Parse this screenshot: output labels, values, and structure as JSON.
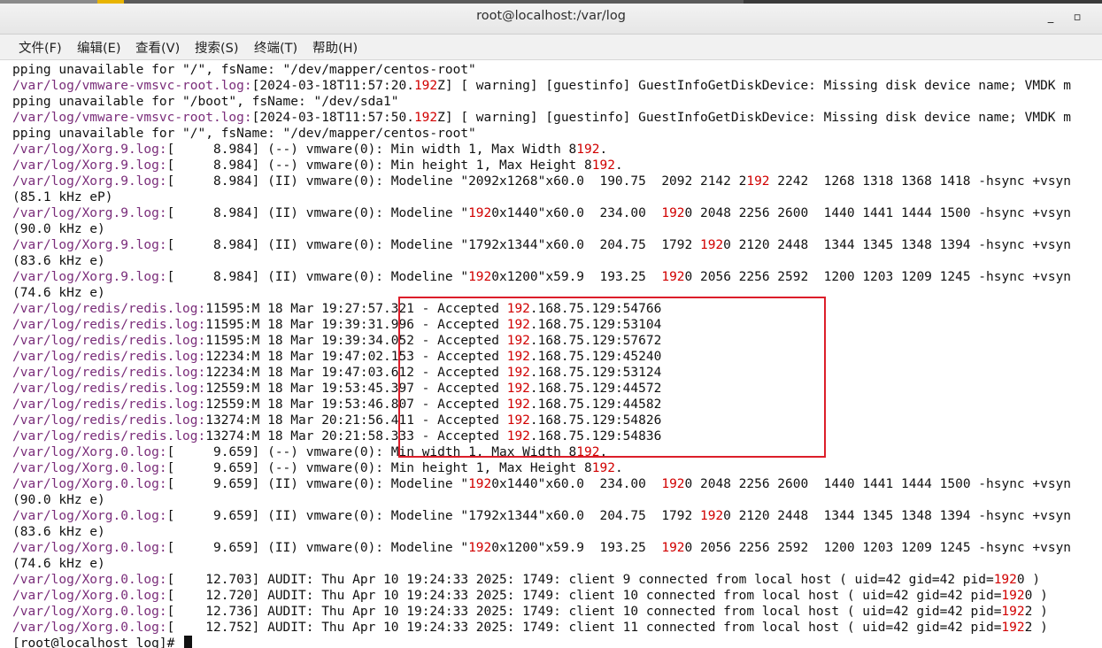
{
  "window": {
    "title": "root@localhost:/var/log",
    "minimize_glyph": "_",
    "maximize_glyph": "▫"
  },
  "menu": [
    "文件(F)",
    "编辑(E)",
    "查看(V)",
    "搜索(S)",
    "终端(T)",
    "帮助(H)"
  ],
  "colors": {
    "filename": "#7a2d7a",
    "highlight": "#d10000",
    "annotation_box": "#dc1e2a"
  },
  "terminal": {
    "highlight_term": "192",
    "lines": [
      "pping unavailable for \"/\", fsName: \"/dev/mapper/centos-root\"",
      "/var/log/vmware-vmsvc-root.log:[2024-03-18T11:57:20.192Z] [ warning] [guestinfo] GuestInfoGetDiskDevice: Missing disk device name; VMDK m",
      "pping unavailable for \"/boot\", fsName: \"/dev/sda1\"",
      "/var/log/vmware-vmsvc-root.log:[2024-03-18T11:57:50.192Z] [ warning] [guestinfo] GuestInfoGetDiskDevice: Missing disk device name; VMDK m",
      "pping unavailable for \"/\", fsName: \"/dev/mapper/centos-root\"",
      "/var/log/Xorg.9.log:[     8.984] (--) vmware(0): Min width 1, Max Width 8192.",
      "/var/log/Xorg.9.log:[     8.984] (--) vmware(0): Min height 1, Max Height 8192.",
      "/var/log/Xorg.9.log:[     8.984] (II) vmware(0): Modeline \"2092x1268\"x60.0  190.75  2092 2142 2192 2242  1268 1318 1368 1418 -hsync +vsyn",
      "(85.1 kHz eP)",
      "/var/log/Xorg.9.log:[     8.984] (II) vmware(0): Modeline \"1920x1440\"x60.0  234.00  1920 2048 2256 2600  1440 1441 1444 1500 -hsync +vsyn",
      "(90.0 kHz e)",
      "/var/log/Xorg.9.log:[     8.984] (II) vmware(0): Modeline \"1792x1344\"x60.0  204.75  1792 1920 2120 2448  1344 1345 1348 1394 -hsync +vsyn",
      "(83.6 kHz e)",
      "/var/log/Xorg.9.log:[     8.984] (II) vmware(0): Modeline \"1920x1200\"x59.9  193.25  1920 2056 2256 2592  1200 1203 1209 1245 -hsync +vsyn",
      "(74.6 kHz e)",
      "/var/log/redis/redis.log:11595:M 18 Mar 19:27:57.321 - Accepted 192.168.75.129:54766",
      "/var/log/redis/redis.log:11595:M 18 Mar 19:39:31.996 - Accepted 192.168.75.129:53104",
      "/var/log/redis/redis.log:11595:M 18 Mar 19:39:34.052 - Accepted 192.168.75.129:57672",
      "/var/log/redis/redis.log:12234:M 18 Mar 19:47:02.153 - Accepted 192.168.75.129:45240",
      "/var/log/redis/redis.log:12234:M 18 Mar 19:47:03.612 - Accepted 192.168.75.129:53124",
      "/var/log/redis/redis.log:12559:M 18 Mar 19:53:45.397 - Accepted 192.168.75.129:44572",
      "/var/log/redis/redis.log:12559:M 18 Mar 19:53:46.807 - Accepted 192.168.75.129:44582",
      "/var/log/redis/redis.log:13274:M 18 Mar 20:21:56.411 - Accepted 192.168.75.129:54826",
      "/var/log/redis/redis.log:13274:M 18 Mar 20:21:58.333 - Accepted 192.168.75.129:54836",
      "/var/log/Xorg.0.log:[     9.659] (--) vmware(0): Min width 1, Max Width 8192.",
      "/var/log/Xorg.0.log:[     9.659] (--) vmware(0): Min height 1, Max Height 8192.",
      "/var/log/Xorg.0.log:[     9.659] (II) vmware(0): Modeline \"1920x1440\"x60.0  234.00  1920 2048 2256 2600  1440 1441 1444 1500 -hsync +vsyn",
      "(90.0 kHz e)",
      "/var/log/Xorg.0.log:[     9.659] (II) vmware(0): Modeline \"1792x1344\"x60.0  204.75  1792 1920 2120 2448  1344 1345 1348 1394 -hsync +vsyn",
      "(83.6 kHz e)",
      "/var/log/Xorg.0.log:[     9.659] (II) vmware(0): Modeline \"1920x1200\"x59.9  193.25  1920 2056 2256 2592  1200 1203 1209 1245 -hsync +vsyn",
      "(74.6 kHz e)",
      "/var/log/Xorg.0.log:[    12.703] AUDIT: Thu Apr 10 19:24:33 2025: 1749: client 9 connected from local host ( uid=42 gid=42 pid=1920 )",
      "/var/log/Xorg.0.log:[    12.720] AUDIT: Thu Apr 10 19:24:33 2025: 1749: client 10 connected from local host ( uid=42 gid=42 pid=1920 )",
      "/var/log/Xorg.0.log:[    12.736] AUDIT: Thu Apr 10 19:24:33 2025: 1749: client 10 connected from local host ( uid=42 gid=42 pid=1922 )",
      "/var/log/Xorg.0.log:[    12.752] AUDIT: Thu Apr 10 19:24:33 2025: 1749: client 11 connected from local host ( uid=42 gid=42 pid=1922 )"
    ],
    "prompt": "[root@localhost log]# "
  }
}
